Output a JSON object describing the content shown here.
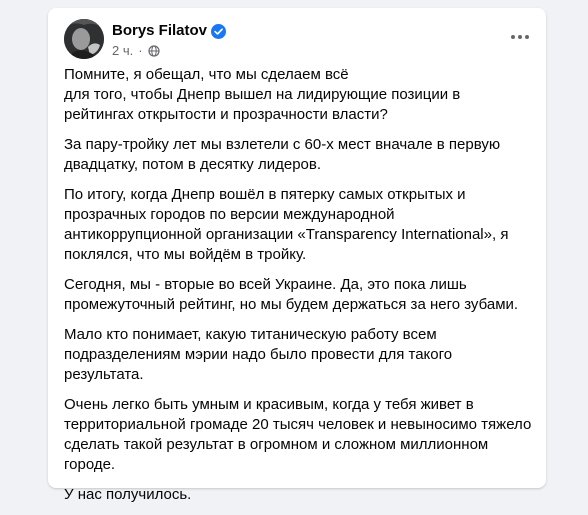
{
  "post": {
    "author": "Borys Filatov",
    "timestamp": "2 ч.",
    "icons": {
      "verified": "verified-badge-icon",
      "audience": "globe-icon",
      "more": "more-options-icon"
    },
    "paragraphs": [
      "Помните, я обещал, что мы сделаем всё\nдля того, чтобы Днепр вышел на лидирующие позиции в\nрейтингах открытости и прозрачности власти?",
      "За пару-тройку лет мы взлетели с 60-х мест вначале в первую\nдвадцатку, потом в десятку лидеров.",
      "По итогу, когда Днепр вошёл в пятерку самых открытых и\nпрозрачных городов по версии международной\nантикоррупционной организации «Transparency International», я\nпоклялся, что мы войдём в тройку.",
      "Сегодня, мы - вторые во всей Украине. Да, это пока лишь\nпромежуточный рейтинг, но мы будем держаться за него зубами.",
      "Мало кто понимает, какую титаническую работу всем\nподразделениям мэрии надо было провести для такого результата.",
      "Очень легко быть умным и красивым, когда у тебя живет в\nтерриториальной громаде 20 тысяч человек и невыносимо тяжело\nсделать такой результат в огромном и сложном миллионном\nгороде.",
      "У нас получилось."
    ]
  },
  "colors": {
    "verified_badge": "#1877f2",
    "secondary_text": "#65676b",
    "primary_text": "#050505",
    "background": "#f0f2f5"
  }
}
